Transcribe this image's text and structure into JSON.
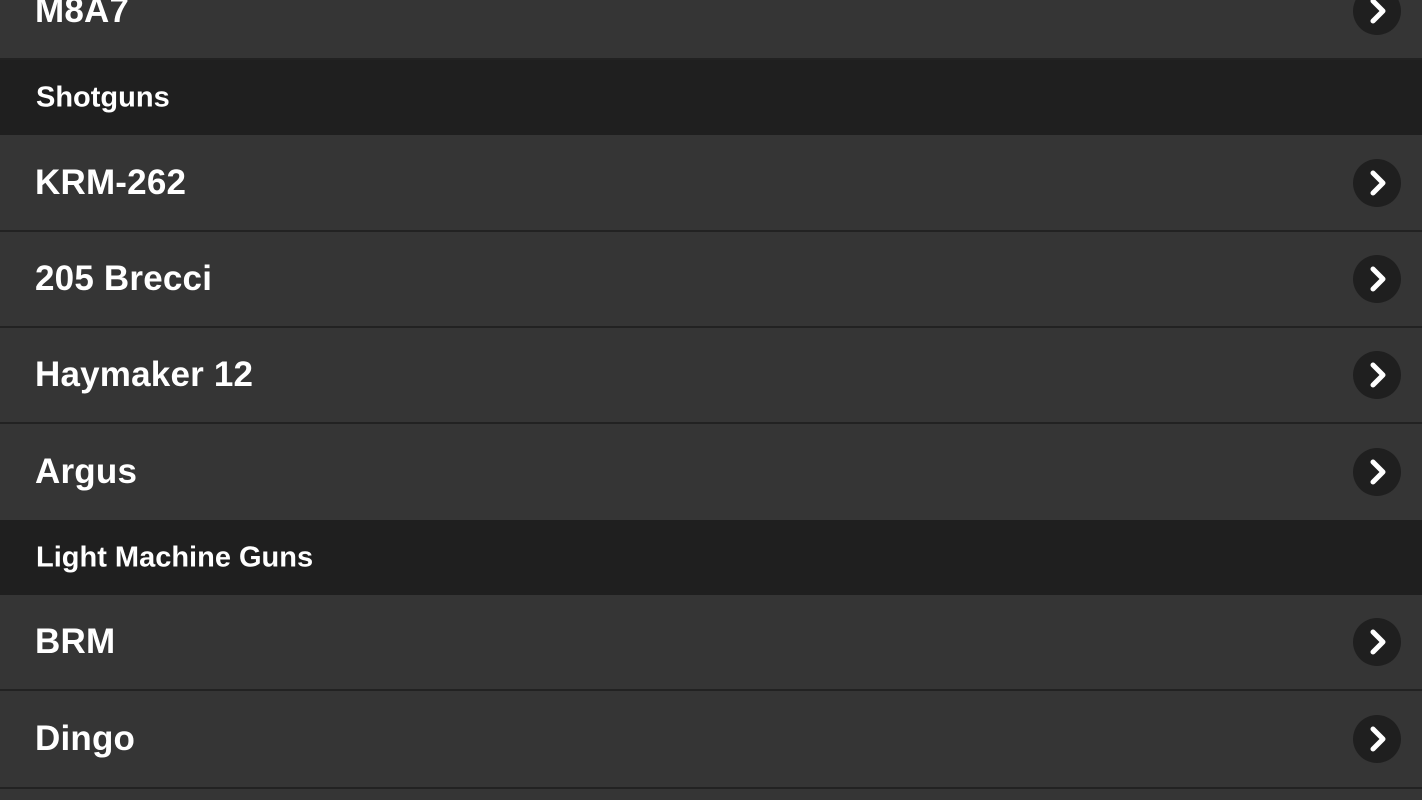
{
  "list": {
    "top_item": {
      "label": "M8A7"
    },
    "sections": [
      {
        "title": "Shotguns",
        "items": [
          {
            "label": "KRM-262"
          },
          {
            "label": "205 Brecci"
          },
          {
            "label": "Haymaker 12"
          },
          {
            "label": "Argus"
          }
        ]
      },
      {
        "title": "Light Machine Guns",
        "items": [
          {
            "label": "BRM"
          },
          {
            "label": "Dingo"
          }
        ]
      }
    ],
    "chevron_icon": "chevron-right-icon",
    "colors": {
      "row_background": "#353535",
      "section_header_background": "#1f1f1f",
      "divider": "#222222",
      "chevron_circle": "#1f1f1f",
      "text": "#ffffff"
    }
  }
}
